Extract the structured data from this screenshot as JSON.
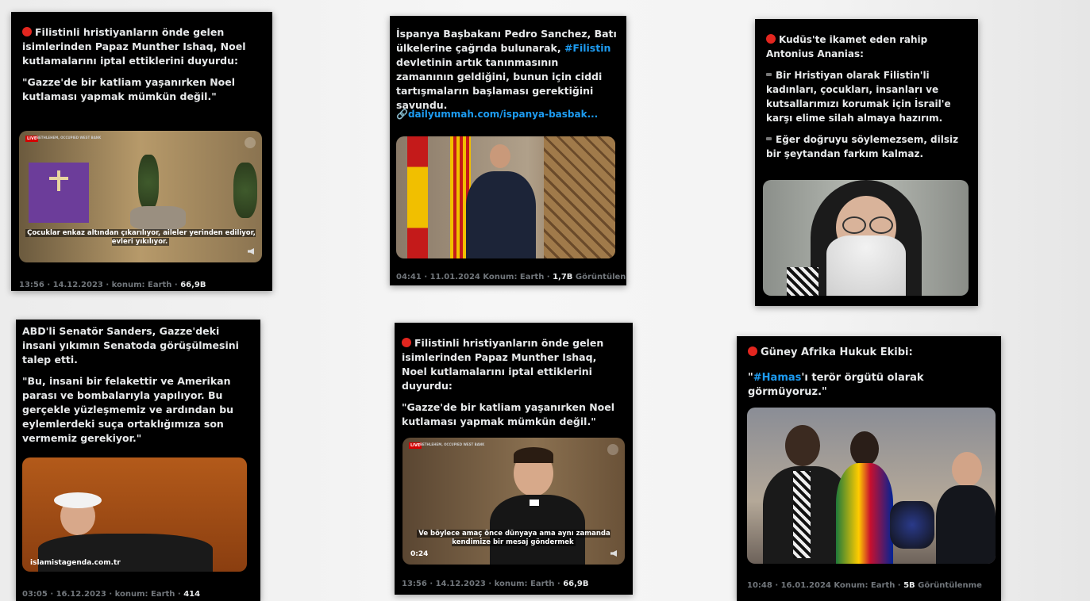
{
  "posts": [
    {
      "headline": "Filistinli hristiyanların önde gelen isimlerinden Papaz Munther Ishaq, Noel kutlamalarını iptal ettiklerini duyurdu:",
      "quote": "\"Gazze'de bir katliam yaşanırken Noel kutlaması yapmak mümkün değil.\"",
      "live": "LIVE",
      "ticker": "BETHLEHEM, OCCUPIED WEST BANK",
      "caption": "Çocuklar enkaz altından çıkarılıyor, aileler yerinden ediliyor, evleri yıkılıyor.",
      "meta": "13:56 · 14.12.2023 · konum: Earth · ",
      "views": "66,9B"
    },
    {
      "text_a": "İspanya Başbakanı Pedro Sanchez, Batı ülkelerine çağrıda bulunarak, ",
      "hashtag": "#Filistin",
      "text_b": " devletinin artık tanınmasının zamanının geldiğini, bunun için ciddi tartışmaların başlaması gerektiğini savundu.",
      "link": "dailyummah.com/ispanya-basbak...",
      "meta": "04:41 · 11.01.2024 Konum: Earth · ",
      "views": "1,7B",
      "views_label": " Görüntülenme"
    },
    {
      "headline": "Kudüs'te ikamet eden rahip Antonius Ananias:",
      "p1": "Bir Hristiyan olarak Filistin'li kadınları, çocukları, insanları ve kutsallarımızı korumak için İsrail'e karşı elime silah almaya hazırım.",
      "p2": "Eğer doğruyu söylemezsem, dilsiz bir şeytandan farkım kalmaz."
    },
    {
      "headline": "ABD'li Senatör Sanders, Gazze'deki insani yıkımın Senatoda görüşülmesini talep etti.",
      "quote": "\"Bu, insani bir felakettir ve Amerikan parası ve bombalarıyla yapılıyor. Bu gerçekle yüzleşmemiz ve ardından bu eylemlerdeki suça ortaklığımıza son vermemiz gerekiyor.\"",
      "watermark": "islamistagenda.com.tr",
      "meta": "03:05 · 16.12.2023 · konum: Earth · ",
      "views": "414"
    },
    {
      "headline": "Filistinli hristiyanların önde gelen isimlerinden Papaz Munther Ishaq, Noel kutlamalarını iptal ettiklerini duyurdu:",
      "quote": "\"Gazze'de bir katliam yaşanırken Noel kutlaması yapmak mümkün değil.\"",
      "live": "LIVE",
      "ticker": "BETHLEHEM, OCCUPIED WEST BANK",
      "caption": "Ve böylece amaç önce dünyaya ama aynı zamanda kendimize bir mesaj göndermek",
      "timecode": "0:24",
      "meta": "13:56 · 14.12.2023 · konum: Earth · ",
      "views": "66,9B"
    },
    {
      "headline": "Güney Afrika Hukuk Ekibi:",
      "q_open": "\"",
      "hashtag": "#Hamas",
      "q_rest": "'ı terör örgütü olarak görmüyoruz.\"",
      "meta": "10:48 · 16.01.2024 Konum: Earth · ",
      "views": "5B",
      "views_label": " Görüntülenme"
    }
  ],
  "colors": {
    "card_bg": "#000000",
    "text": "#e7e9ea",
    "link": "#1d9bf0",
    "muted": "#71767b",
    "red_dot": "#e3261f"
  },
  "icons": [
    "red-circle-icon",
    "link-icon",
    "dash-icon",
    "volume-icon",
    "settings-icon"
  ]
}
